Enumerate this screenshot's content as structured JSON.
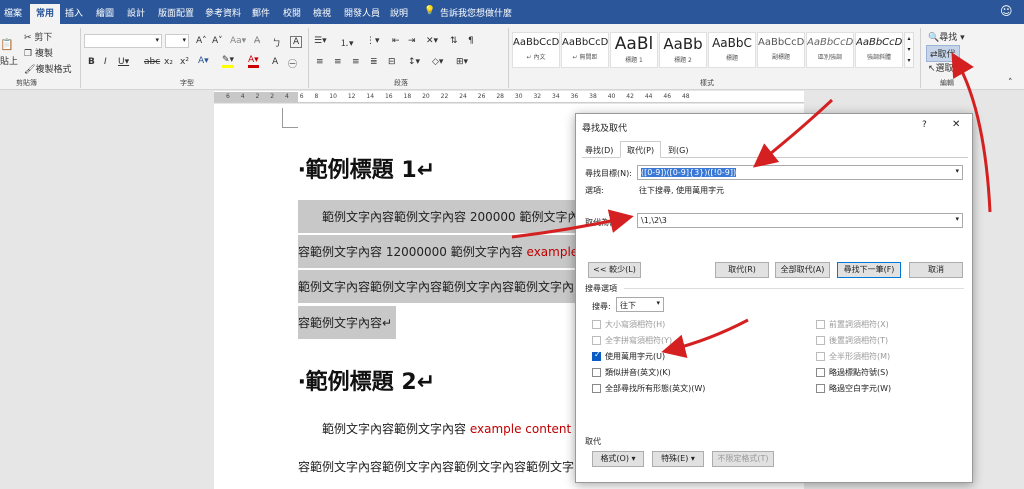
{
  "menubar": {
    "items": [
      "檔案",
      "常用",
      "插入",
      "繪圖",
      "設計",
      "版面配置",
      "參考資料",
      "郵件",
      "校閱",
      "檢視",
      "開發人員",
      "說明"
    ],
    "tell_me": "告訴我您想做什麼"
  },
  "ribbon": {
    "clipboard": {
      "cut": "剪下",
      "copy": "複製",
      "format_painter": "複製格式",
      "paste": "貼上",
      "group": "剪貼簿"
    },
    "font": {
      "group": "字型",
      "font_size": ""
    },
    "paragraph": {
      "group": "段落"
    },
    "styles": {
      "group": "樣式",
      "items": [
        {
          "preview": "AaBbCcD",
          "name": "↵ 內文"
        },
        {
          "preview": "AaBbCcD",
          "name": "↵ 無間距"
        },
        {
          "preview": "AaBl",
          "name": "標題 1"
        },
        {
          "preview": "AaBb",
          "name": "標題 2"
        },
        {
          "preview": "AaBbC",
          "name": "標題"
        },
        {
          "preview": "AaBbCcD",
          "name": "副標題"
        },
        {
          "preview": "AaBbCcD",
          "name": "區別強調"
        },
        {
          "preview": "AaBbCcD",
          "name": "強調斜體"
        }
      ]
    },
    "editing": {
      "find": "尋找",
      "replace": "取代",
      "select": "選取",
      "group": "編輯"
    }
  },
  "ruler": {
    "ticks": [
      "6",
      "4",
      "2",
      "",
      "2",
      "4",
      "6",
      "8",
      "10",
      "12",
      "14",
      "16",
      "18",
      "20",
      "22",
      "24",
      "26",
      "28",
      "30",
      "32",
      "34",
      "36",
      "38",
      "40",
      "42",
      "44",
      "46",
      "48"
    ]
  },
  "document": {
    "heading1": "‧範例標題 1↵",
    "p1_line1": "範例文字內容範例文字內容 200000 範例文字內",
    "p1_line2a": "容範例文字內容 12000000 範例文字內容 ",
    "p1_line2b": "example c",
    "p1_line3": "範例文字內容範例文字內容範例文字內容範例文字內",
    "p1_line4": "容範例文字內容↵",
    "heading2": "‧範例標題 2↵",
    "p2_line1a": "範例文字內容範例文字內容 ",
    "p2_line1b": "example content te",
    "p2_line2": "容範例文字內容範例文字內容範例文字內容範例文字內"
  },
  "dialog": {
    "title": "尋找及取代",
    "help": "?",
    "close": "✕",
    "tabs": [
      "尋找(D)",
      "取代(P)",
      "到(G)"
    ],
    "find_label": "尋找目標(N):",
    "find_value": "([0-9])([0-9]{3})([!0-9])",
    "options_label": "選項:",
    "options_value": "往下搜尋, 使用萬用字元",
    "replace_label": "取代為(I):",
    "replace_value": "\\1,\\2\\3",
    "less_button": "<< 較少(L)",
    "replace_button": "取代(R)",
    "replace_all_button": "全部取代(A)",
    "find_next_button": "尋找下一筆(F)",
    "cancel_button": "取消",
    "search_options_title": "搜尋選項",
    "search_label": "搜尋:",
    "search_value": "往下",
    "left_options": [
      {
        "label": "大小寫須相符(H)",
        "checked": false,
        "disabled": true
      },
      {
        "label": "全字拼寫須相符(Y)",
        "checked": false,
        "disabled": true
      },
      {
        "label": "使用萬用字元(U)",
        "checked": true,
        "disabled": false
      },
      {
        "label": "類似拼音(英文)(K)",
        "checked": false,
        "disabled": false
      },
      {
        "label": "全部尋找所有形態(英文)(W)",
        "checked": false,
        "disabled": false
      }
    ],
    "right_options": [
      {
        "label": "前置詞須相符(X)",
        "checked": false,
        "disabled": true
      },
      {
        "label": "後置詞須相符(T)",
        "checked": false,
        "disabled": true
      },
      {
        "label": "全半形須相符(M)",
        "checked": false,
        "disabled": true
      },
      {
        "label": "略過標點符號(S)",
        "checked": false,
        "disabled": false
      },
      {
        "label": "略過空白字元(W)",
        "checked": false,
        "disabled": false
      }
    ],
    "replace_section": "取代",
    "format_button": "格式(O) ▾",
    "special_button": "特殊(E) ▾",
    "no_format_button": "不限定格式(T)"
  },
  "colors": {
    "brand": "#2b579a",
    "annotation": "#d42020",
    "highlight": "#c8c8c8"
  }
}
